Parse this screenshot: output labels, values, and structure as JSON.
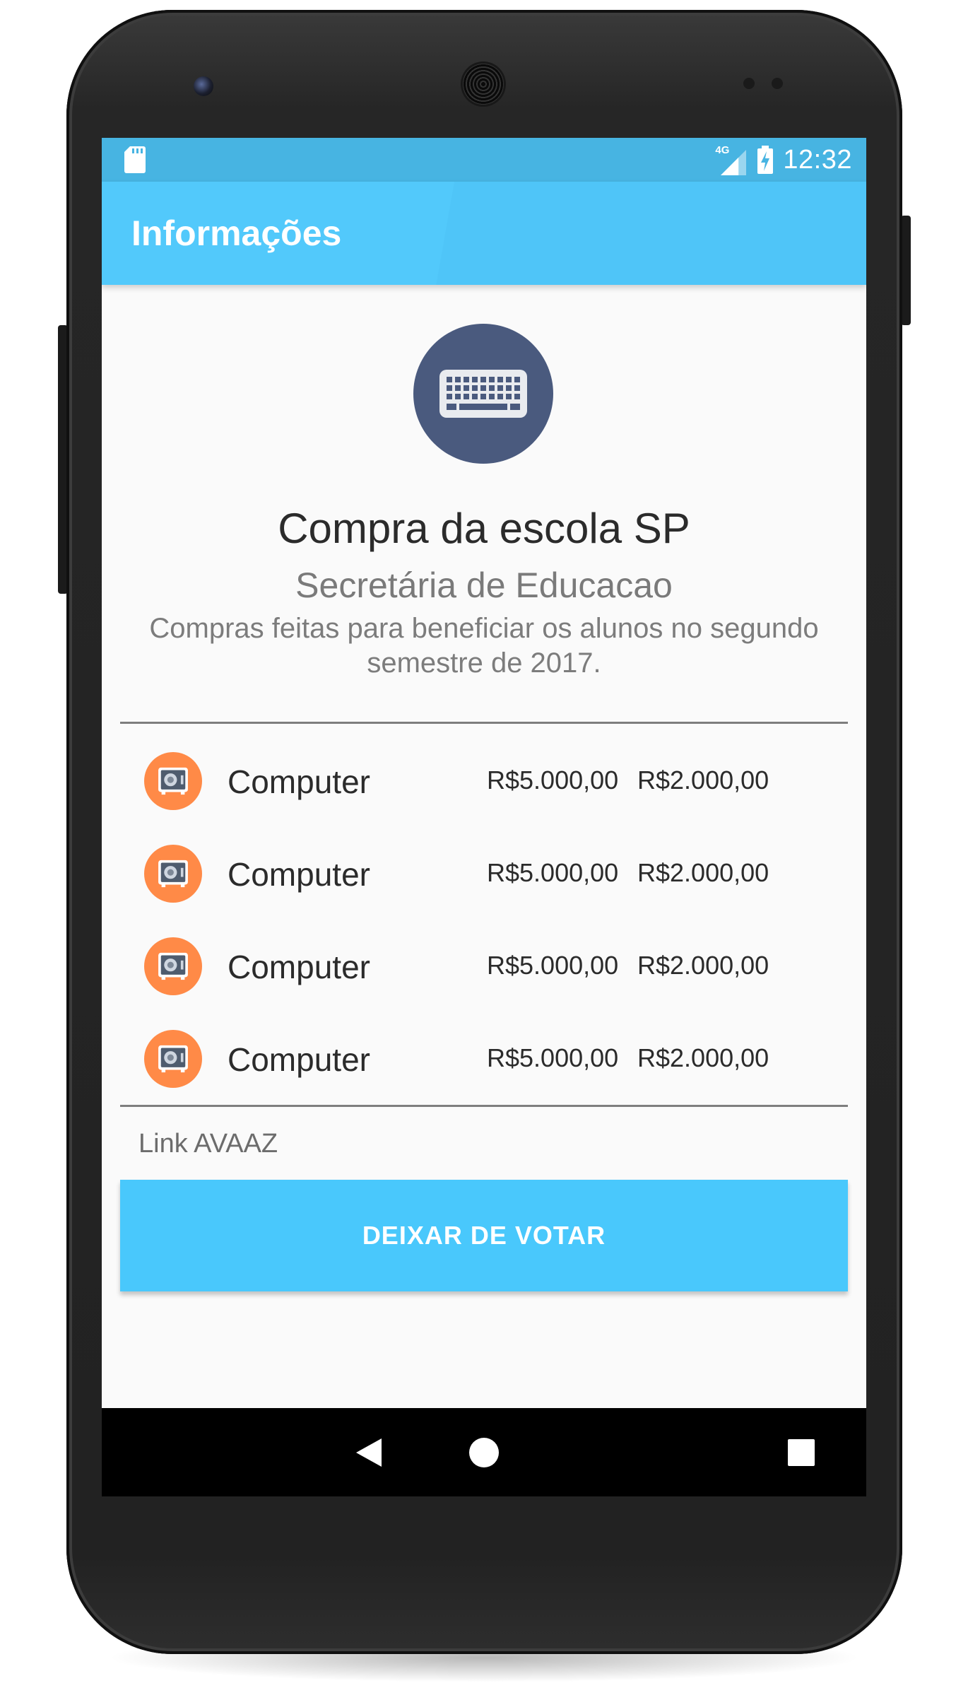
{
  "status_bar": {
    "network": "4G",
    "time": "12:32"
  },
  "app_bar": {
    "title": "Informações"
  },
  "header": {
    "icon": "keyboard-icon",
    "title": "Compra da escola SP",
    "subtitle": "Secretária de Educacao",
    "description": "Compras feitas para beneficiar os alunos no segundo semestre de 2017."
  },
  "items": [
    {
      "icon": "safe-icon",
      "name": "Computer",
      "price_1": "R$5.000,00",
      "price_2": "R$2.000,00"
    },
    {
      "icon": "safe-icon",
      "name": "Computer",
      "price_1": "R$5.000,00",
      "price_2": "R$2.000,00"
    },
    {
      "icon": "safe-icon",
      "name": "Computer",
      "price_1": "R$5.000,00",
      "price_2": "R$2.000,00"
    },
    {
      "icon": "safe-icon",
      "name": "Computer",
      "price_1": "R$5.000,00",
      "price_2": "R$2.000,00"
    }
  ],
  "link_label": "Link AVAAZ",
  "vote_button_label": "DEIXAR DE VOTAR",
  "colors": {
    "status_bar": "#47b4e2",
    "app_bar": "#52c9fb",
    "button": "#49c8fc",
    "item_icon_bg": "#ff8a47",
    "logo_bg": "#4a5a7e"
  }
}
